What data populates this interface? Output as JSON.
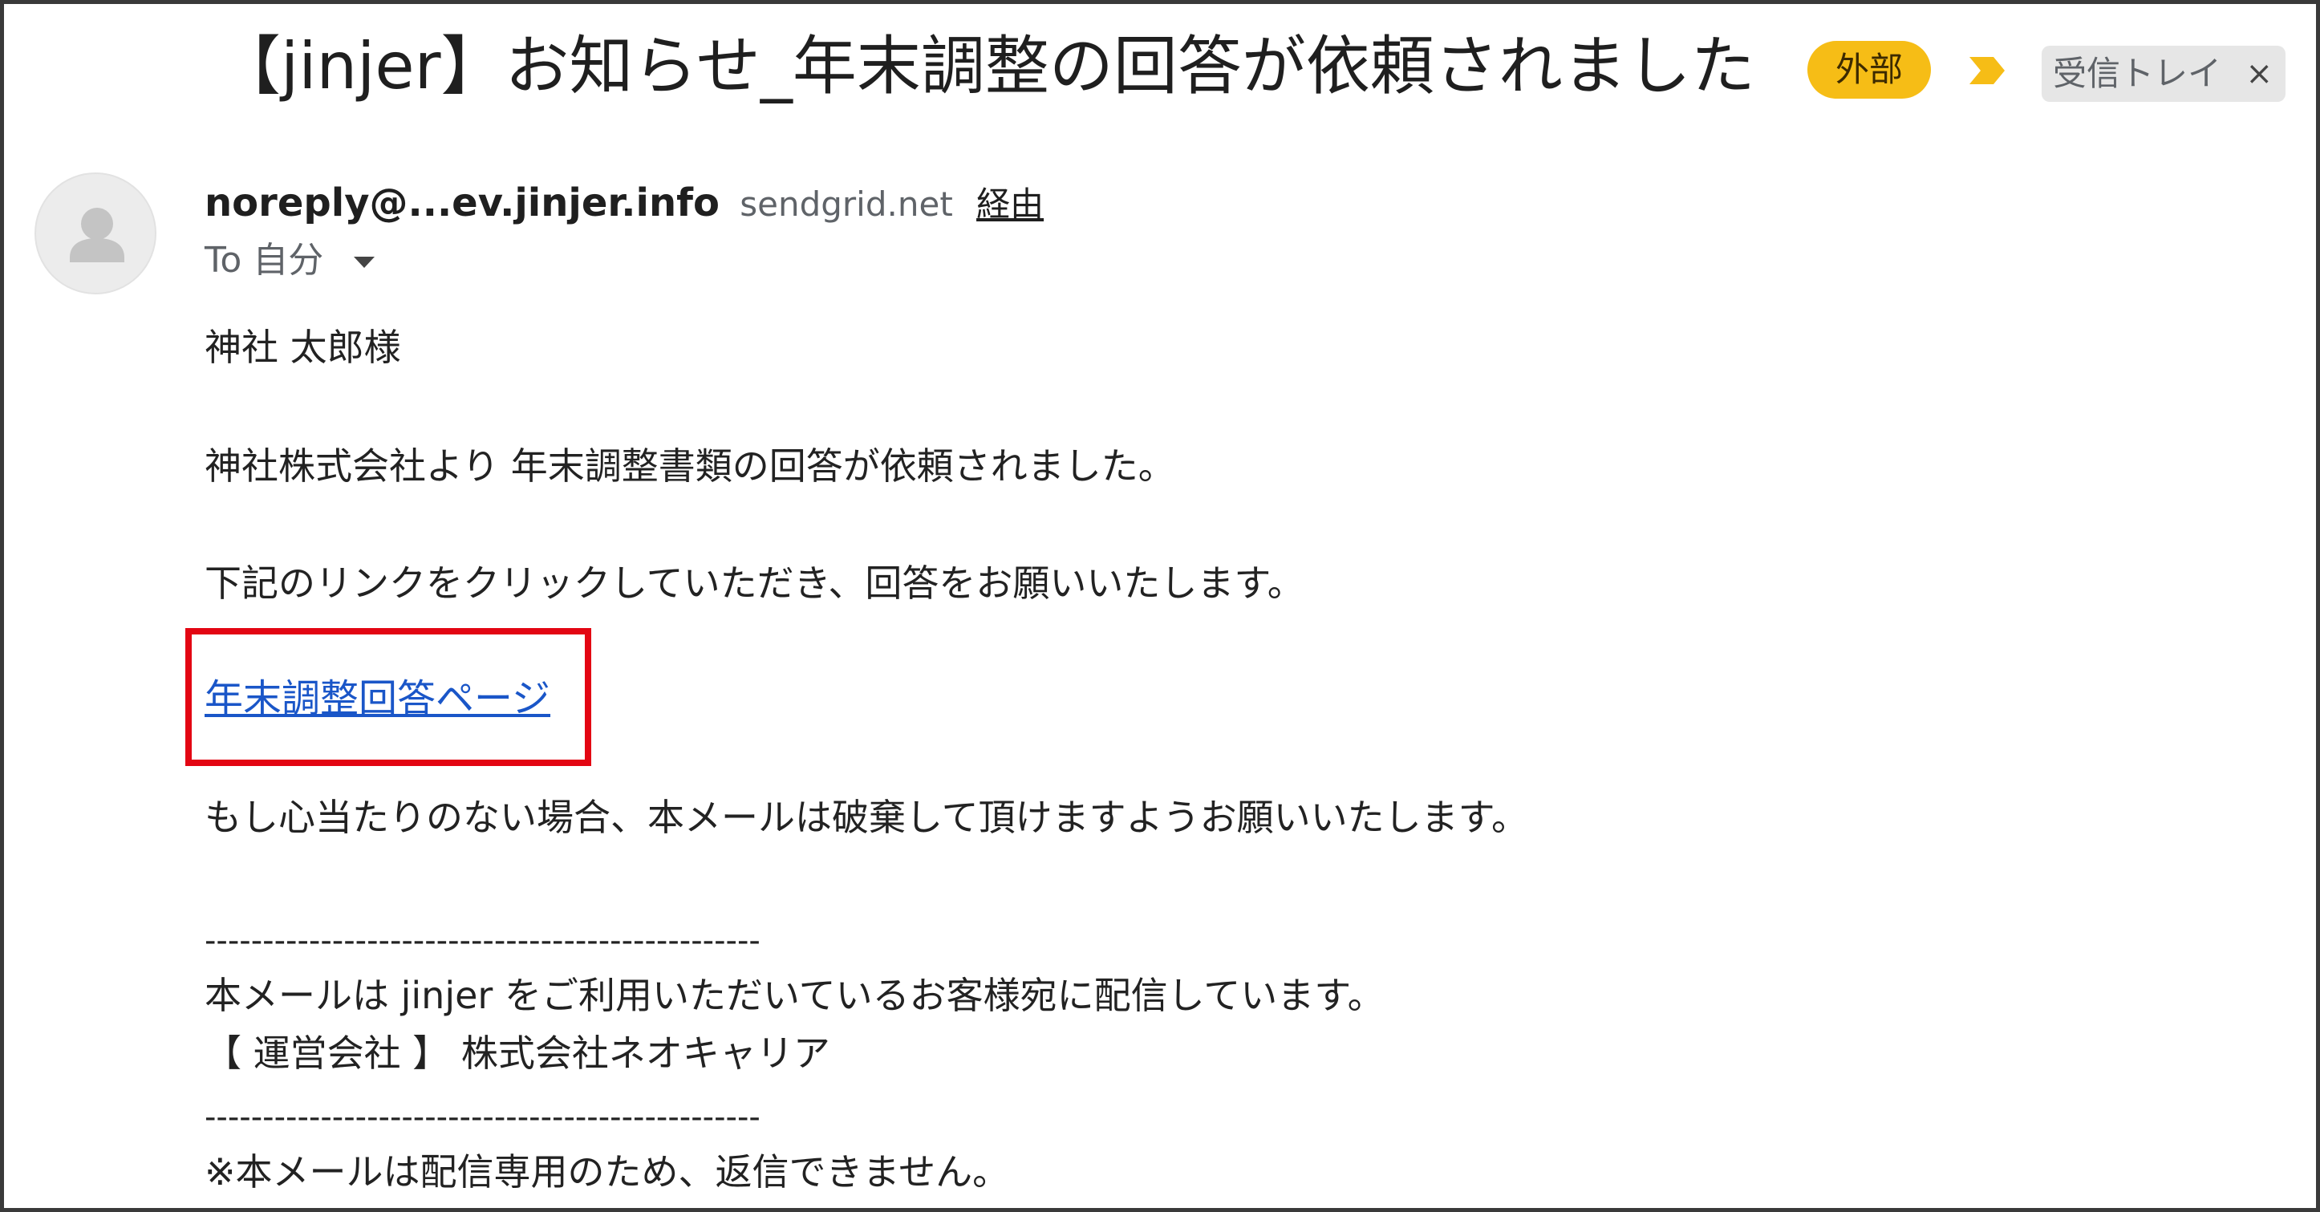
{
  "email": {
    "subject": "【jinjer】お知らせ_年末調整の回答が依頼されました",
    "badge_external": "外部",
    "label_inbox": "受信トレイ",
    "label_remove": "×",
    "sender_email": "noreply@...ev.jinjer.info",
    "sender_via_domain": "sendgrid.net",
    "sender_via_link": "経由",
    "to_text": "To 自分",
    "body": {
      "greeting": "神社 太郎様",
      "line1": "神社株式会社より 年末調整書類の回答が依頼されました。",
      "line2": "下記のリンクをクリックしていただき、回答をお願いいたします。",
      "link_text": "年末調整回答ページ",
      "line3": "もし心当たりのない場合、本メールは破棄して頂けますようお願いいたします。",
      "separator": "------------------------------------------------",
      "footer1": "本メールは jinjer をご利用いただいているお客様宛に配信しています。",
      "footer2": "【 運営会社 】 株式会社ネオキャリア",
      "footer3": "※本メールは配信専用のため、返信できません。"
    }
  },
  "colors": {
    "external_badge": "#f6bd16",
    "important_marker": "#f6bd16",
    "link": "#1a56c8",
    "highlight_box": "#e30613"
  },
  "icons": {
    "important": "important-marker-icon",
    "avatar": "default-avatar-icon",
    "to_expand": "caret-down-icon"
  }
}
